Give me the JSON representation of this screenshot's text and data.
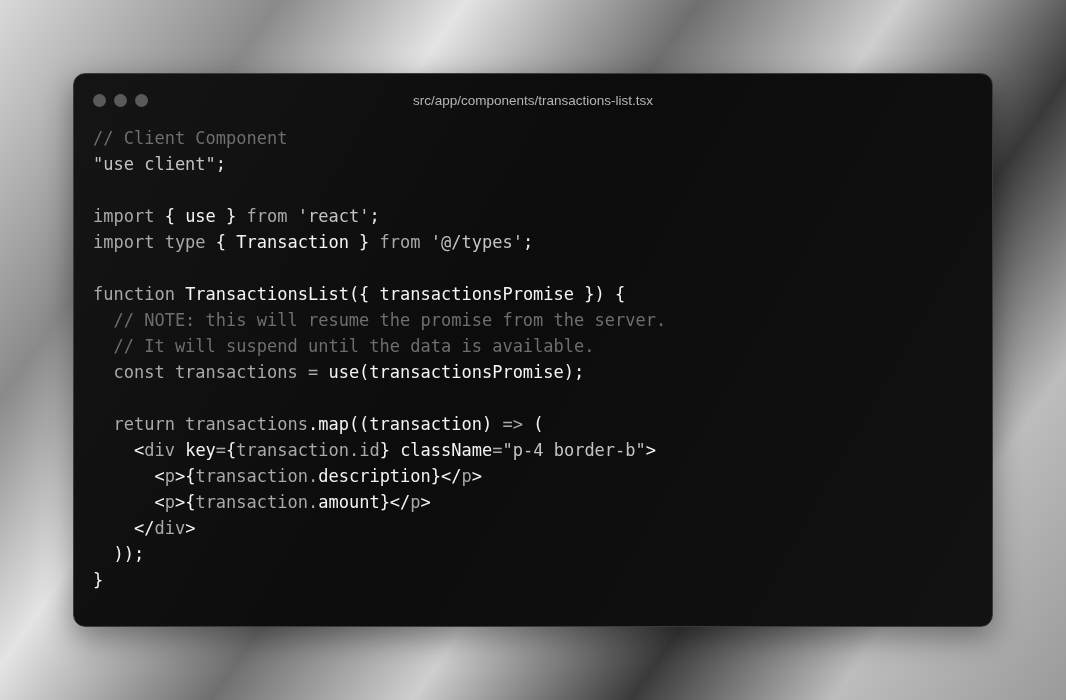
{
  "window": {
    "title": "src/app/components/transactions-list.tsx"
  },
  "code": {
    "lines": [
      {
        "kind": "code",
        "tokens": [
          {
            "kind": "comment",
            "text": "// Client Component"
          }
        ]
      },
      {
        "kind": "code",
        "tokens": [
          {
            "kind": "string",
            "text": "\"use client\""
          },
          {
            "kind": "punct",
            "text": ";"
          }
        ]
      },
      {
        "kind": "blank"
      },
      {
        "kind": "code",
        "tokens": [
          {
            "kind": "keyword",
            "text": "import "
          },
          {
            "kind": "name",
            "text": "{ use }"
          },
          {
            "kind": "keyword",
            "text": " from "
          },
          {
            "kind": "string",
            "text": "'react'"
          },
          {
            "kind": "punct",
            "text": ";"
          }
        ]
      },
      {
        "kind": "code",
        "tokens": [
          {
            "kind": "keyword",
            "text": "import type "
          },
          {
            "kind": "name",
            "text": "{ Transaction }"
          },
          {
            "kind": "keyword",
            "text": " from "
          },
          {
            "kind": "string",
            "text": "'@/types'"
          },
          {
            "kind": "punct",
            "text": ";"
          }
        ]
      },
      {
        "kind": "blank"
      },
      {
        "kind": "code",
        "tokens": [
          {
            "kind": "keyword",
            "text": "function "
          },
          {
            "kind": "name",
            "text": "TransactionsList({ transactionsPromise }) {"
          }
        ]
      },
      {
        "kind": "code",
        "tokens": [
          {
            "kind": "comment",
            "text": "  // NOTE: this will resume the promise from the server."
          }
        ]
      },
      {
        "kind": "code",
        "tokens": [
          {
            "kind": "comment",
            "text": "  // It will suspend until the data is available."
          }
        ]
      },
      {
        "kind": "code",
        "tokens": [
          {
            "kind": "keyword",
            "text": "  const transactions = "
          },
          {
            "kind": "name",
            "text": "use(transactionsPromise);"
          }
        ]
      },
      {
        "kind": "blank"
      },
      {
        "kind": "code",
        "tokens": [
          {
            "kind": "keyword",
            "text": "  return transactions"
          },
          {
            "kind": "name",
            "text": ".map((transaction) "
          },
          {
            "kind": "keyword",
            "text": "=>"
          },
          {
            "kind": "name",
            "text": " ("
          }
        ]
      },
      {
        "kind": "code",
        "tokens": [
          {
            "kind": "name",
            "text": "    <"
          },
          {
            "kind": "keyword",
            "text": "div "
          },
          {
            "kind": "name",
            "text": "key"
          },
          {
            "kind": "keyword",
            "text": "="
          },
          {
            "kind": "name",
            "text": "{"
          },
          {
            "kind": "keyword",
            "text": "transaction.id"
          },
          {
            "kind": "name",
            "text": "} className"
          },
          {
            "kind": "keyword",
            "text": "="
          },
          {
            "kind": "string",
            "text": "\"p-4 border-b\""
          },
          {
            "kind": "name",
            "text": ">"
          }
        ]
      },
      {
        "kind": "code",
        "tokens": [
          {
            "kind": "name",
            "text": "      <"
          },
          {
            "kind": "keyword",
            "text": "p"
          },
          {
            "kind": "name",
            "text": ">{"
          },
          {
            "kind": "keyword",
            "text": "transaction."
          },
          {
            "kind": "name",
            "text": "description}</"
          },
          {
            "kind": "keyword",
            "text": "p"
          },
          {
            "kind": "name",
            "text": ">"
          }
        ]
      },
      {
        "kind": "code",
        "tokens": [
          {
            "kind": "name",
            "text": "      <"
          },
          {
            "kind": "keyword",
            "text": "p"
          },
          {
            "kind": "name",
            "text": ">{"
          },
          {
            "kind": "keyword",
            "text": "transaction."
          },
          {
            "kind": "name",
            "text": "amount}</"
          },
          {
            "kind": "keyword",
            "text": "p"
          },
          {
            "kind": "name",
            "text": ">"
          }
        ]
      },
      {
        "kind": "code",
        "tokens": [
          {
            "kind": "name",
            "text": "    </"
          },
          {
            "kind": "keyword",
            "text": "div"
          },
          {
            "kind": "name",
            "text": ">"
          }
        ]
      },
      {
        "kind": "code",
        "tokens": [
          {
            "kind": "name",
            "text": "  ));"
          }
        ]
      },
      {
        "kind": "code",
        "tokens": [
          {
            "kind": "name",
            "text": "}"
          }
        ]
      }
    ]
  }
}
